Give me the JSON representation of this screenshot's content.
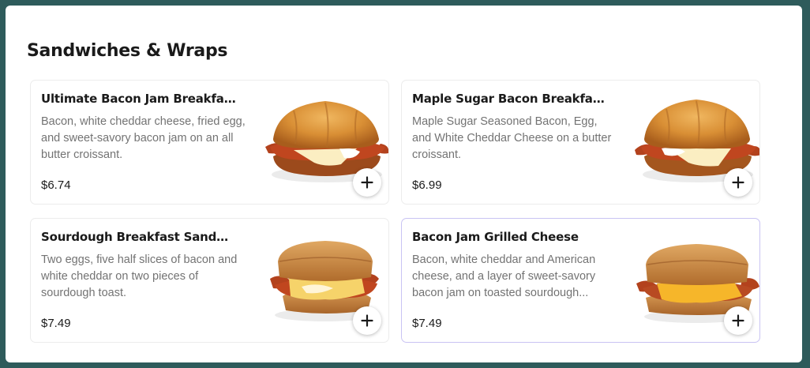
{
  "section": {
    "title": "Sandwiches & Wraps"
  },
  "colors": {
    "frame": "#2e5b5b",
    "card_border": "#ececec",
    "highlight_border": "#c9c3f3",
    "desc_text": "#737373"
  },
  "items": [
    {
      "name": "Ultimate Bacon Jam Breakfast S...",
      "description": "Bacon, white cheddar cheese, fried egg, and sweet-savory bacon jam on an all butter croissant.",
      "price": "$6.74",
      "image_icon": "croissant-sandwich-image",
      "add_icon": "plus-icon"
    },
    {
      "name": "Maple Sugar Bacon Breakfast Sa...",
      "description": "Maple Sugar Seasoned Bacon, Egg, and White Cheddar Cheese on a butter croissant.",
      "price": "$6.99",
      "image_icon": "croissant-sandwich-image",
      "add_icon": "plus-icon"
    },
    {
      "name": "Sourdough Breakfast Sandwich",
      "description": "Two eggs, five half slices of bacon and white cheddar on two pieces of sourdough toast.",
      "price": "$7.49",
      "image_icon": "sourdough-sandwich-image",
      "add_icon": "plus-icon"
    },
    {
      "name": "Bacon Jam Grilled Cheese",
      "description": "Bacon, white cheddar and American cheese, and a layer of sweet-savory bacon jam on toasted sourdough...",
      "price": "$7.49",
      "image_icon": "grilled-cheese-image",
      "add_icon": "plus-icon"
    }
  ]
}
